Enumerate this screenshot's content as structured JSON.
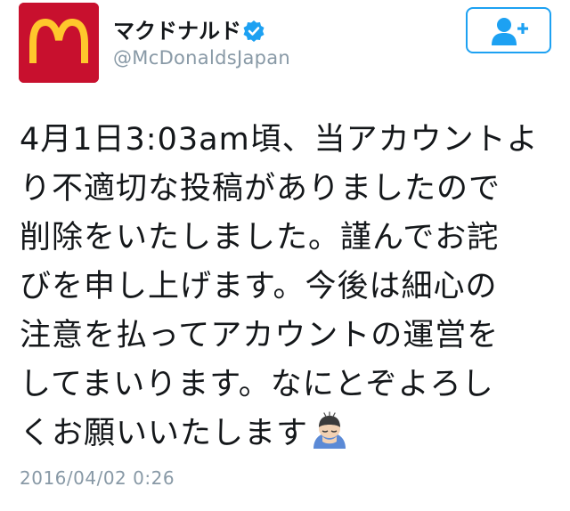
{
  "account": {
    "display_name": "マクドナルド",
    "handle": "@McDonaldsJapan",
    "verified": true,
    "avatar_icon": "mcdonalds-logo",
    "avatar_color": "#c8102e",
    "logo_color": "#ffc72c"
  },
  "follow_button": {
    "icon": "add-user-icon",
    "color": "#1da1f2"
  },
  "tweet": {
    "lines": [
      "4月1日3:03am頃、当アカウントよ",
      "り不適切な投稿がありましたので",
      "削除をいたしました。謹んでお詫",
      "びを申し上げます。今後は細心の",
      "注意を払ってアカウントの運営を",
      "してまいります。なにとぞよろし",
      "くお願いいたします"
    ],
    "trailing_emoji": "person-bowing-emoji",
    "timestamp": "2016/04/02 0:26"
  }
}
